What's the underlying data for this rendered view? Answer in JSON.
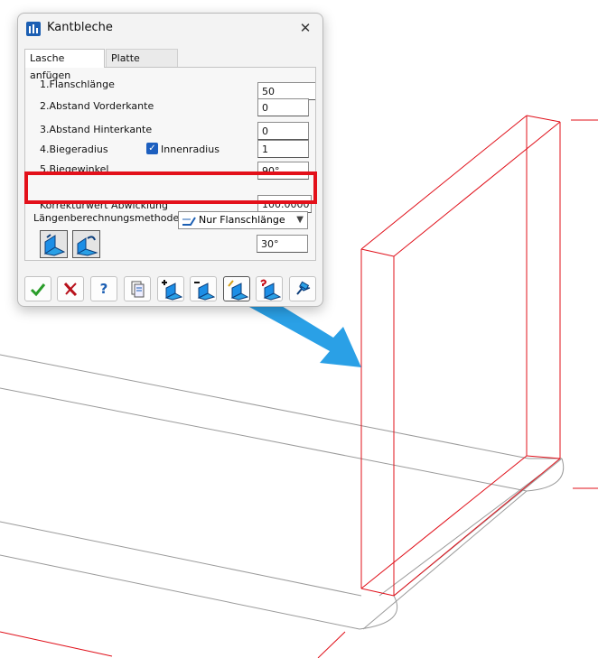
{
  "window": {
    "title": "Kantbleche",
    "close_glyph": "✕",
    "icon": "app-icon"
  },
  "tabs": [
    {
      "label": "Lasche anfügen",
      "active": true
    },
    {
      "label": "Platte anfügen",
      "active": false
    }
  ],
  "fields": {
    "flanschlaenge": {
      "label": "1.Flanschlänge",
      "value": "50"
    },
    "abstand_vorderkante": {
      "label": "2.Abstand Vorderkante",
      "value": "0"
    },
    "abstand_hinterkante": {
      "label": "3.Abstand Hinterkante",
      "value": "0"
    },
    "biegeradius": {
      "label": "4.Biegeradius",
      "value": "1"
    },
    "innenradius": {
      "label": "Innenradius",
      "checked": true
    },
    "biegewinkel": {
      "label": "5.Biegewinkel",
      "value": "90°"
    },
    "korrekturwert": {
      "label": "Korrekturwert Abwicklung",
      "value": "100.0000"
    }
  },
  "laengenberechnung": {
    "label": "Längenberechnungsmethode",
    "selected": "Nur Flanschlänge",
    "angle": "30°"
  },
  "toolbar": [
    {
      "name": "ok-button",
      "icon": "checkmark-icon"
    },
    {
      "name": "cancel-button",
      "icon": "cancel-icon"
    },
    {
      "name": "help-button",
      "icon": "help-icon",
      "glyph": "?"
    },
    {
      "name": "document-button",
      "icon": "document-icon"
    },
    {
      "name": "add-flange-button",
      "icon": "add-flange-icon"
    },
    {
      "name": "remove-flange-button",
      "icon": "remove-flange-icon"
    },
    {
      "name": "edit-flange-button",
      "icon": "edit-flange-icon"
    },
    {
      "name": "query-flange-button",
      "icon": "query-flange-icon"
    },
    {
      "name": "pin-button",
      "icon": "pin-icon"
    }
  ],
  "colors": {
    "accent": "#1c5fb3",
    "highlight": "#e3101a",
    "arrow": "#2aa0e6",
    "edge": "#e0101a",
    "line": "#9a9a9a"
  }
}
